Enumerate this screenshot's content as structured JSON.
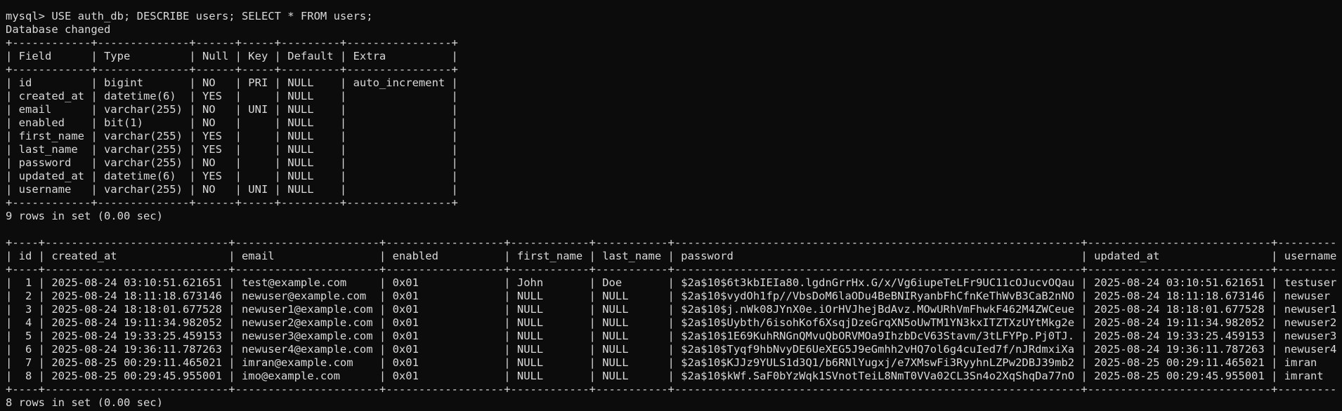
{
  "terminal": {
    "lines": [
      "mysql> USE auth_db; DESCRIBE users; SELECT * FROM users;",
      "Database changed",
      "+------------+--------------+------+-----+---------+----------------+",
      "| Field      | Type         | Null | Key | Default | Extra          |",
      "+------------+--------------+------+-----+---------+----------------+",
      "| id         | bigint       | NO   | PRI | NULL    | auto_increment |",
      "| created_at | datetime(6)  | YES  |     | NULL    |                |",
      "| email      | varchar(255) | NO   | UNI | NULL    |                |",
      "| enabled    | bit(1)       | NO   |     | NULL    |                |",
      "| first_name | varchar(255) | YES  |     | NULL    |                |",
      "| last_name  | varchar(255) | YES  |     | NULL    |                |",
      "| password   | varchar(255) | NO   |     | NULL    |                |",
      "| updated_at | datetime(6)  | YES  |     | NULL    |                |",
      "| username   | varchar(255) | NO   | UNI | NULL    |                |",
      "+------------+--------------+------+-----+---------+----------------+",
      "9 rows in set (0.00 sec)",
      "",
      "+----+----------------------------+----------------------+------------------+------------+-----------+--------------------------------------------------------------+----------------------------+-----------+",
      "| id | created_at                 | email                | enabled          | first_name | last_name | password                                                     | updated_at                 | username  |",
      "+----+----------------------------+----------------------+------------------+------------+-----------+--------------------------------------------------------------+----------------------------+-----------+",
      "|  1 | 2025-08-24 03:10:51.621651 | test@example.com     | 0x01             | John       | Doe       | $2a$10$6t3kbIEIa80.lgdnGrrHx.G/x/Vg6iupeTeLFr9UC11cOJucvOQau | 2025-08-24 03:10:51.621651 | testuser  |",
      "|  2 | 2025-08-24 18:11:18.673146 | newuser@example.com  | 0x01             | NULL       | NULL      | $2a$10$vydOh1fp//VbsDoM6laODu4BeBNIRyanbFhCfnKeThWvB3CaB2nNO | 2025-08-24 18:11:18.673146 | newuser   |",
      "|  3 | 2025-08-24 18:18:01.677528 | newuser1@example.com | 0x01             | NULL       | NULL      | $2a$10$j.nWk08JYnX0e.iOrHVJhejBdAvz.MOwURhVmFhwkF462M4ZWCeue | 2025-08-24 18:18:01.677528 | newuser1  |",
      "|  4 | 2025-08-24 19:11:34.982052 | newuser2@example.com | 0x01             | NULL       | NULL      | $2a$10$Uybth/6isohKof6XsqjDzeGrqXN5oUwTM1YN3kxITZTXzUYtMkg2e | 2025-08-24 19:11:34.982052 | newuser2  |",
      "|  5 | 2025-08-24 19:33:25.459153 | newuser3@example.com | 0x01             | NULL       | NULL      | $2a$10$1E69KuhRNGnQMvuQbORVMOa9IhzbDcV63Stavm/3tLFYPp.Pj0TJ. | 2025-08-24 19:33:25.459153 | newuser3  |",
      "|  6 | 2025-08-24 19:36:11.787263 | newuser4@example.com | 0x01             | NULL       | NULL      | $2a$10$Tyqf9hbNvyDE6UeXEG5J9eGmhh2vHQ7ol6g4cuIed7f/nJRdmxiXa | 2025-08-24 19:36:11.787263 | newuser4  |",
      "|  7 | 2025-08-25 00:29:11.465021 | imran@example.com    | 0x01             | NULL       | NULL      | $2a$10$KJJz9YULS1d3Q1/b6RNlYugxj/e7XMswFi3RyyhnLZPw2DBJ39mb2 | 2025-08-25 00:29:11.465021 | imran     |",
      "|  8 | 2025-08-25 00:29:45.955001 | imo@example.com      | 0x01             | NULL       | NULL      | $2a$10$kWf.SaF0bYzWqk1SVnotTeiL8NmT0VVa02CL3Sn4o2XqShqDa77nO | 2025-08-25 00:29:45.955001 | imrant    |",
      "+----+----------------------------+----------------------+------------------+------------+-----------+--------------------------------------------------------------+----------------------------+-----------+",
      "8 rows in set (0.00 sec)"
    ]
  },
  "colors": {
    "background": "#0c0c0c",
    "text": "#d9d9d9"
  }
}
